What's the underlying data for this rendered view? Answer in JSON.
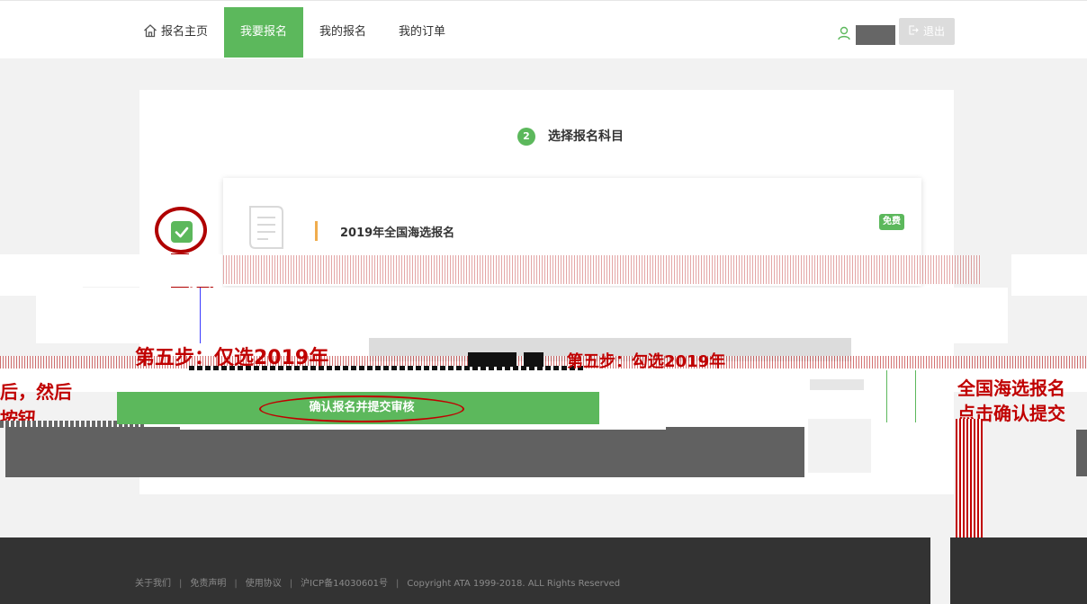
{
  "nav": {
    "home_label": "报名主页",
    "signup_label": "我要报名",
    "my_signups_label": "我的报名",
    "my_orders_label": "我的订单",
    "logout_label": "退出"
  },
  "step": {
    "number": "2",
    "title": "选择报名科目"
  },
  "subject": {
    "name": "2019年全国海选报名",
    "badge": "免费",
    "checked": true
  },
  "annotations": {
    "left_top": "第五步：仅选2019年",
    "left_mid": "后，然后",
    "left_bottom": "按钮。",
    "center": "第五步：勾选2019年",
    "right_mid": "全国海选报名",
    "right_bottom": "点击确认提交"
  },
  "confirm_button": "确认报名并提交审核",
  "footer": {
    "links": [
      "关于我们",
      "免责声明",
      "使用协议",
      "沪ICP备14030601号",
      "Copyright ATA 1999-2018. ALL Rights Reserved"
    ],
    "separator": "|"
  },
  "colors": {
    "accent_green": "#5cb85c",
    "annotation_red": "#c00000",
    "footer_bg": "#333333",
    "orange_marker": "#f0ad4e"
  }
}
